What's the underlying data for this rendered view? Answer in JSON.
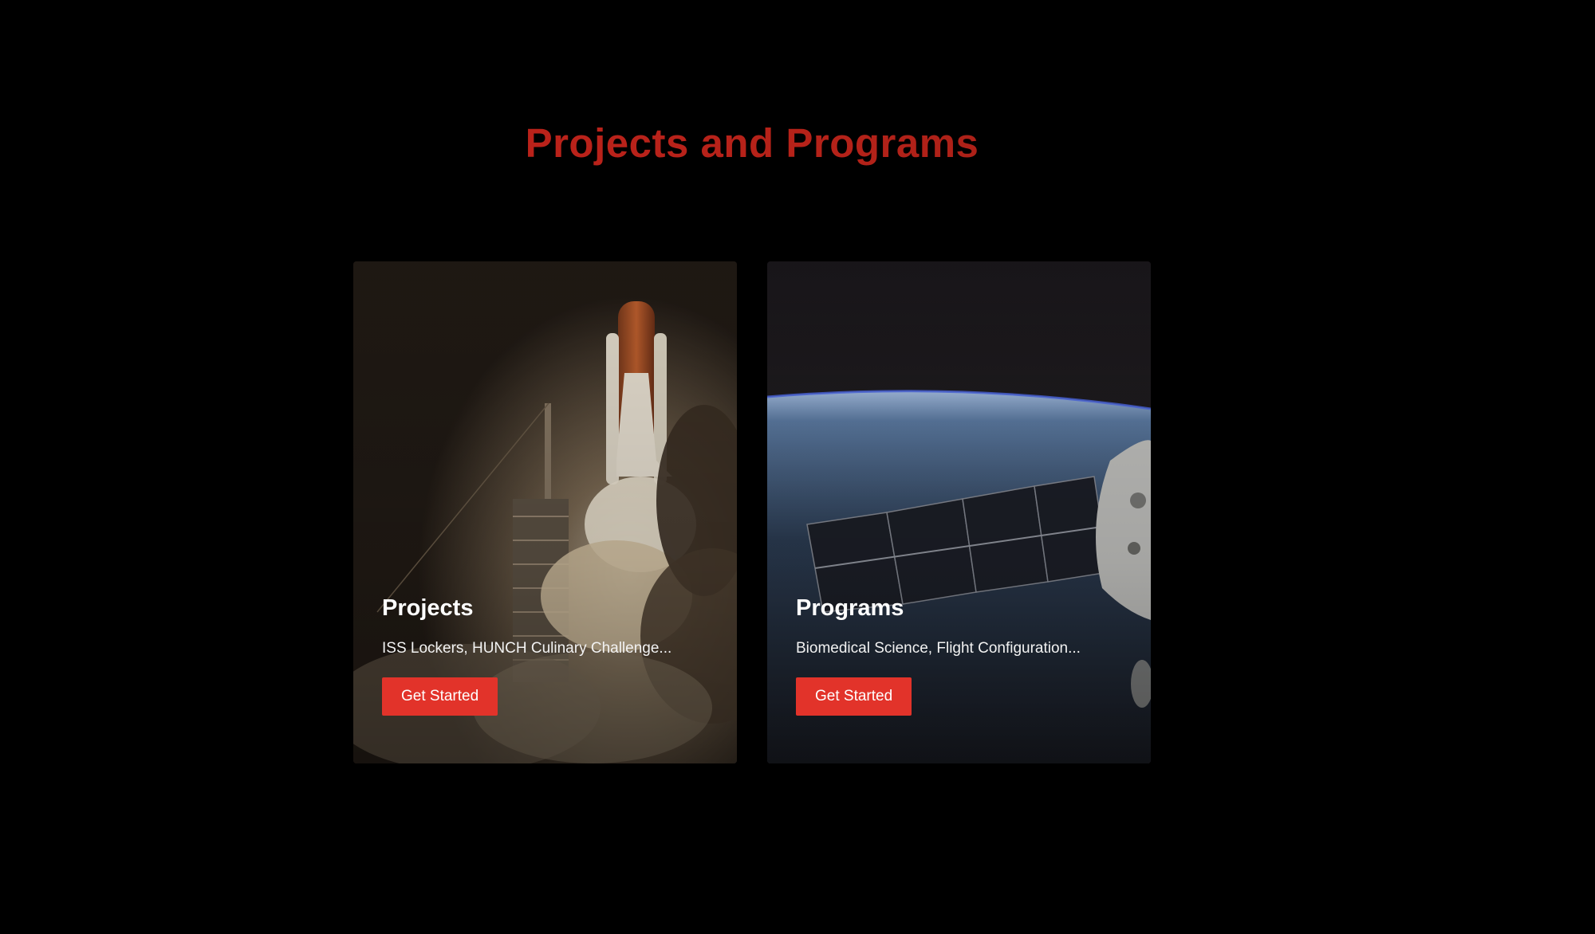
{
  "section": {
    "title": "Projects and Programs"
  },
  "cards": [
    {
      "title": "Projects",
      "description": "ISS Lockers, HUNCH Culinary Challenge...",
      "button_label": "Get Started",
      "image": "space-shuttle-launch"
    },
    {
      "title": "Programs",
      "description": "Biomedical Science, Flight Configuration...",
      "button_label": "Get Started",
      "image": "earth-orbit-station"
    }
  ],
  "colors": {
    "background": "#000000",
    "title_accent": "#b52219",
    "button": "#e2332a",
    "card_text": "#ffffff"
  }
}
